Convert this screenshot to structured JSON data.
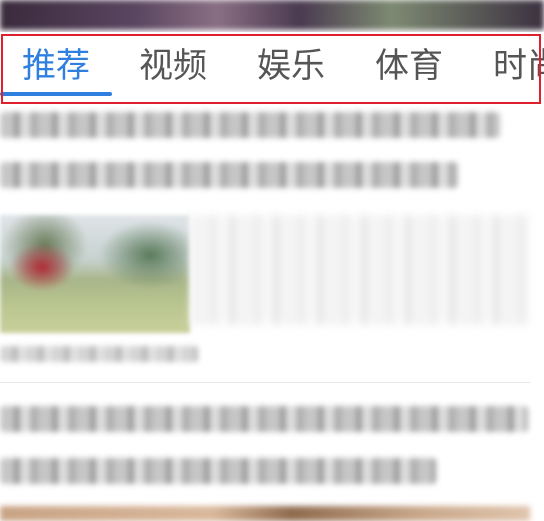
{
  "tabs": [
    {
      "label": "推荐",
      "active": true
    },
    {
      "label": "视频",
      "active": false
    },
    {
      "label": "娱乐",
      "active": false
    },
    {
      "label": "体育",
      "active": false
    },
    {
      "label": "时尚",
      "active": false
    }
  ],
  "colors": {
    "accent": "#2f7fe0",
    "inactive_tab": "#555555",
    "highlight_outline": "#e0202c"
  }
}
